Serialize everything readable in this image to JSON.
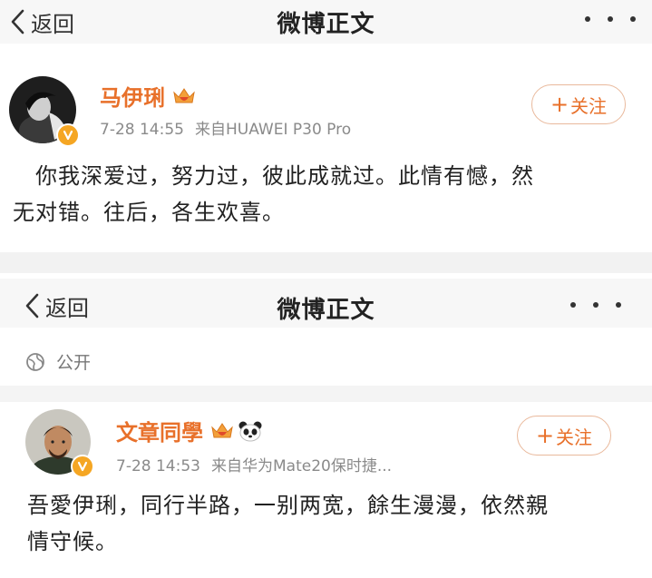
{
  "nav": {
    "back_label": "返回",
    "title": "微博正文"
  },
  "posts": [
    {
      "username": "马伊琍",
      "time": "7-28 14:55",
      "source": "来自HUAWEI P30 Pro",
      "follow_label": "关注",
      "text_lines": [
        "　你我深爱过，努力过，彼此成就过。此情有憾，然",
        "无对错。往后，各生欢喜。"
      ]
    },
    {
      "privacy": "公开",
      "username": "文章同學",
      "time": "7-28 14:53",
      "source": "来自华为Mate20保时捷...",
      "follow_label": "关注",
      "text_lines": [
        "吾愛伊琍，同行半路，一别两宽，餘生漫漫，依然親",
        "情守候。"
      ]
    }
  ],
  "icons": [
    "back-chevron-icon",
    "more-dots-icon",
    "verified-badge-icon",
    "crown-badge-icon",
    "panda-icon",
    "globe-icon",
    "plus-icon"
  ],
  "colors": {
    "username": "#e8702a",
    "follow_border": "#e9b99c",
    "meta_text": "#8a8a8a",
    "badge": "#f5a623",
    "navbar_bg": "#f7f7f7"
  }
}
